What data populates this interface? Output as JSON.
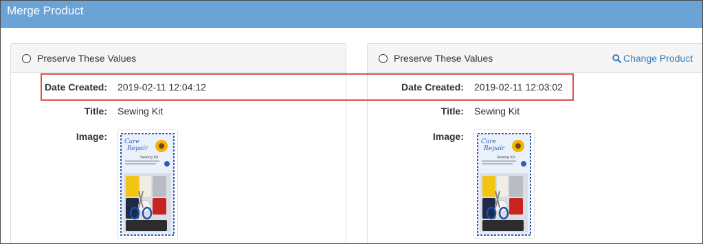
{
  "window": {
    "title": "Merge Product"
  },
  "left_panel": {
    "header_label": "Preserve These Values",
    "fields": {
      "date_created_label": "Date Created:",
      "date_created_value": "2019-02-11 12:04:12",
      "title_label": "Title:",
      "title_value": "Sewing Kit",
      "image_label": "Image:"
    },
    "image_text": {
      "brand_line1": "Care",
      "brand_line2": "Repair",
      "product": "Sewing Kit"
    }
  },
  "right_panel": {
    "header_label": "Preserve These Values",
    "change_link": "Change Product",
    "fields": {
      "date_created_label": "Date Created:",
      "date_created_value": "2019-02-11 12:03:02",
      "title_label": "Title:",
      "title_value": "Sewing Kit",
      "image_label": "Image:"
    },
    "image_text": {
      "brand_line1": "Care",
      "brand_line2": "Repair",
      "product": "Sewing Kit"
    }
  },
  "colors": {
    "title_bar": "#6aa3d5",
    "highlight_border": "#d9534f",
    "link": "#337ab7"
  },
  "icons": {
    "change_product": "search-icon"
  }
}
